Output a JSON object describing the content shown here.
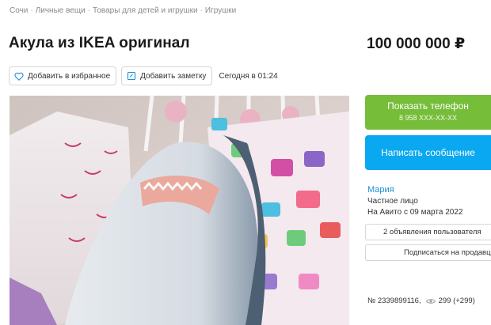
{
  "breadcrumb": {
    "items": [
      "Сочи",
      "Личные вещи",
      "Товары для детей и игрушки",
      "Игрушки"
    ],
    "separator": "·"
  },
  "listing": {
    "title": "Акула из IKEA оригинал",
    "price": "100 000 000 ₽",
    "favorite_label": "Добавить в избранное",
    "note_label": "Добавить заметку",
    "posted": "Сегодня в 01:24"
  },
  "contact": {
    "show_phone_label": "Показать телефон",
    "phone_masked": "8 958 XXX-XX-XX",
    "message_label": "Написать сообщение",
    "phone_color": "#76bd3a",
    "message_color": "#0aa8f0"
  },
  "seller": {
    "name": "Мария",
    "type": "Частное лицо",
    "since": "На Авито с 09 марта 2022",
    "listings_button": "2 объявления пользователя",
    "subscribe_button": "Подписаться на продавца"
  },
  "meta": {
    "id": "№ 2339899116,",
    "views": "299 (+299)"
  },
  "icons": {
    "favorite": "heart-icon",
    "note": "note-icon",
    "views": "eye-icon"
  }
}
